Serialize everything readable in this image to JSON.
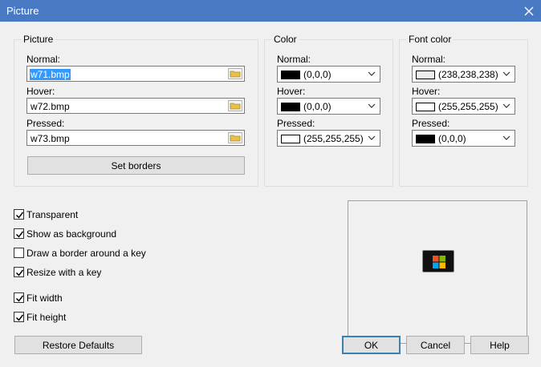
{
  "window": {
    "title": "Picture"
  },
  "picture_group": {
    "label": "Picture",
    "normal_label": "Normal:",
    "normal_value": "w71.bmp",
    "hover_label": "Hover:",
    "hover_value": "w72.bmp",
    "pressed_label": "Pressed:",
    "pressed_value": "w73.bmp",
    "set_borders_label": "Set borders"
  },
  "color_group": {
    "label": "Color",
    "normal_label": "Normal:",
    "normal_value": "(0,0,0)",
    "normal_swatch": "#000000",
    "hover_label": "Hover:",
    "hover_value": "(0,0,0)",
    "hover_swatch": "#000000",
    "pressed_label": "Pressed:",
    "pressed_value": "(255,255,255)",
    "pressed_swatch": "#ffffff"
  },
  "font_color_group": {
    "label": "Font color",
    "normal_label": "Normal:",
    "normal_value": "(238,238,238)",
    "normal_swatch": "#eeeeee",
    "hover_label": "Hover:",
    "hover_value": "(255,255,255)",
    "hover_swatch": "#ffffff",
    "pressed_label": "Pressed:",
    "pressed_value": "(0,0,0)",
    "pressed_swatch": "#000000"
  },
  "options": {
    "transparent": {
      "label": "Transparent",
      "checked": true
    },
    "show_as_background": {
      "label": "Show as background",
      "checked": true
    },
    "draw_border": {
      "label": "Draw a border around a key",
      "checked": false
    },
    "resize_with_key": {
      "label": "Resize with a key",
      "checked": true
    },
    "fit_width": {
      "label": "Fit width",
      "checked": true
    },
    "fit_height": {
      "label": "Fit height",
      "checked": true
    }
  },
  "buttons": {
    "restore_defaults": "Restore Defaults",
    "ok": "OK",
    "cancel": "Cancel",
    "help": "Help"
  },
  "colors": {
    "titlebar": "#4a79c4",
    "selection": "#3399ff",
    "default_button_border": "#3c7fb1"
  },
  "icons": {
    "close": "close-icon",
    "browse": "folder-icon",
    "dropdown": "chevron-down-icon",
    "preview": "windows-logo-icon"
  }
}
